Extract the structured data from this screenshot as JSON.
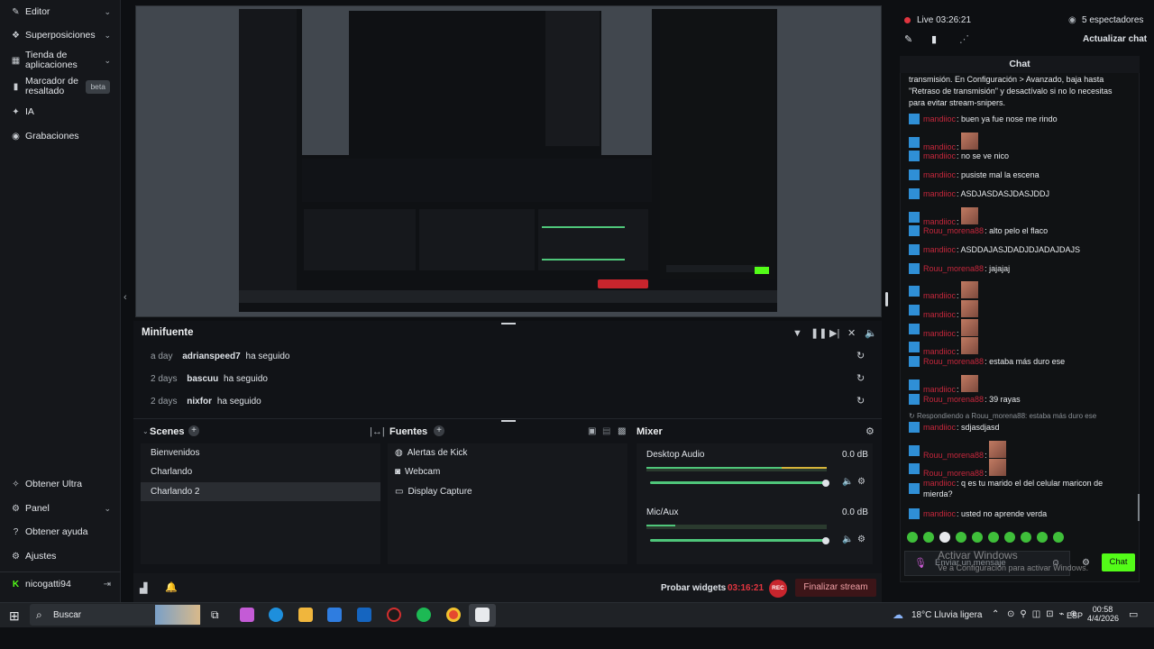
{
  "sidebar": {
    "items": [
      {
        "label": "Editor",
        "icon": "pencil-icon",
        "chevron": "⌄"
      },
      {
        "label": "Superposiciones",
        "icon": "layers-icon",
        "chevron": "⌄"
      },
      {
        "label": "Tienda de aplicaciones",
        "icon": "store-icon",
        "chevron": "⌄"
      },
      {
        "label": "Marcador de resaltado",
        "icon": "bookmark-icon",
        "badge": "beta"
      },
      {
        "label": "IA",
        "icon": "sparkle-icon"
      },
      {
        "label": "Grabaciones",
        "icon": "record-icon"
      }
    ],
    "bottom_items": [
      {
        "label": "Obtener Ultra",
        "icon": "ultra-icon"
      },
      {
        "label": "Panel",
        "icon": "panel-icon",
        "chevron": "⌄"
      },
      {
        "label": "Obtener ayuda",
        "icon": "help-icon"
      },
      {
        "label": "Ajustes",
        "icon": "gear-icon"
      }
    ],
    "user": "nicogatti94"
  },
  "activity": {
    "title": "Minifuente",
    "rows": [
      {
        "time": "a day",
        "user": "adrianspeed7",
        "action": "ha seguido"
      },
      {
        "time": "2 days",
        "user": "bascuu",
        "action": "ha seguido"
      },
      {
        "time": "2 days",
        "user": "nixfor",
        "action": "ha seguido"
      }
    ]
  },
  "scenes": {
    "title": "Scenes",
    "items": [
      "Bienvenidos",
      "Charlando",
      "Charlando 2"
    ],
    "selected": 2
  },
  "sources": {
    "title": "Fuentes",
    "items": [
      {
        "label": "Alertas de Kick",
        "icon": "globe-icon"
      },
      {
        "label": "Webcam",
        "icon": "camera-icon"
      },
      {
        "label": "Display Capture",
        "icon": "monitor-icon"
      }
    ]
  },
  "mixer": {
    "title": "Mixer",
    "channels": [
      {
        "name": "Desktop Audio",
        "db": "0.0 dB",
        "level": 0.95
      },
      {
        "name": "Mic/Aux",
        "db": "0.0 dB",
        "level": 0.15
      }
    ]
  },
  "footer": {
    "test_widgets": "Probar widgets",
    "timer": "03:16:21",
    "rec": "REC",
    "end_stream": "Finalizar stream"
  },
  "live": {
    "status": "Live 03:26:21",
    "viewers": "5 espectadores",
    "update_chat": "Actualizar chat"
  },
  "chat": {
    "title": "Chat",
    "intro_1": "transmisión. En Configuración > Avanzado, baja hasta",
    "intro_2": "\"Retraso de transmisión\" y desactívalo si no lo necesitas",
    "intro_3": "para evitar stream-snipers.",
    "messages": [
      {
        "user": "mandiioc",
        "text": ": buen ya fue nose me rindo"
      },
      {
        "user": "mandiioc",
        "text": ":",
        "emote": true
      },
      {
        "user": "mandiioc",
        "text": ": no se ve nico"
      },
      {
        "user": "mandiioc",
        "text": ": pusiste mal la escena"
      },
      {
        "user": "mandiioc",
        "text": ": ASDJASDASJDASJDDJ"
      },
      {
        "user": "mandiioc",
        "text": ":",
        "emote": true
      },
      {
        "user": "Rouu_morena88",
        "text": ": alto pelo el flaco"
      },
      {
        "user": "mandiioc",
        "text": ": ASDDAJASJDADJDJADAJDAJS"
      },
      {
        "user": "Rouu_morena88",
        "text": ": jajajaj"
      },
      {
        "user": "mandiioc",
        "text": ":",
        "emote": true
      },
      {
        "user": "mandiioc",
        "text": ":",
        "emote": true
      },
      {
        "user": "mandiioc",
        "text": ":",
        "emote": true
      },
      {
        "user": "mandiioc",
        "text": ":",
        "emote": true
      },
      {
        "user": "Rouu_morena88",
        "text": ": estaba más duro ese"
      },
      {
        "user": "mandiioc",
        "text": ":",
        "emote": true
      },
      {
        "user": "Rouu_morena88",
        "text": ": 39 rayas"
      }
    ],
    "reply_ref": "Respondiendo a Rouu_morena88: estaba más duro ese",
    "messages2": [
      {
        "user": "mandiioc",
        "text": ": sdjasdjasd"
      },
      {
        "user": "Rouu_morena88",
        "text": ":",
        "emote": true
      },
      {
        "user": "Rouu_morena88",
        "text": ":",
        "emote": true
      },
      {
        "user": "mandiioc",
        "text": ": q es tu marido el del celular maricon de mierda?"
      },
      {
        "user": "mandiioc",
        "text": ": usted no aprende verda"
      }
    ],
    "input_placeholder": "Enviar un mensaje",
    "send_label": "Chat",
    "watermark_title": "Activar Windows",
    "watermark_sub": "Ve a Configuración para activar Windows."
  },
  "taskbar": {
    "search": "Buscar",
    "weather": "18°C Lluvia ligera",
    "lang": "ESP",
    "time": "00:58",
    "date": "4/4/2026"
  },
  "colors": {
    "accent_green": "#53fc18",
    "kick_blue": "#2f8fd6",
    "chat_user": "#c6273c",
    "end_stream": "#c8252d"
  }
}
